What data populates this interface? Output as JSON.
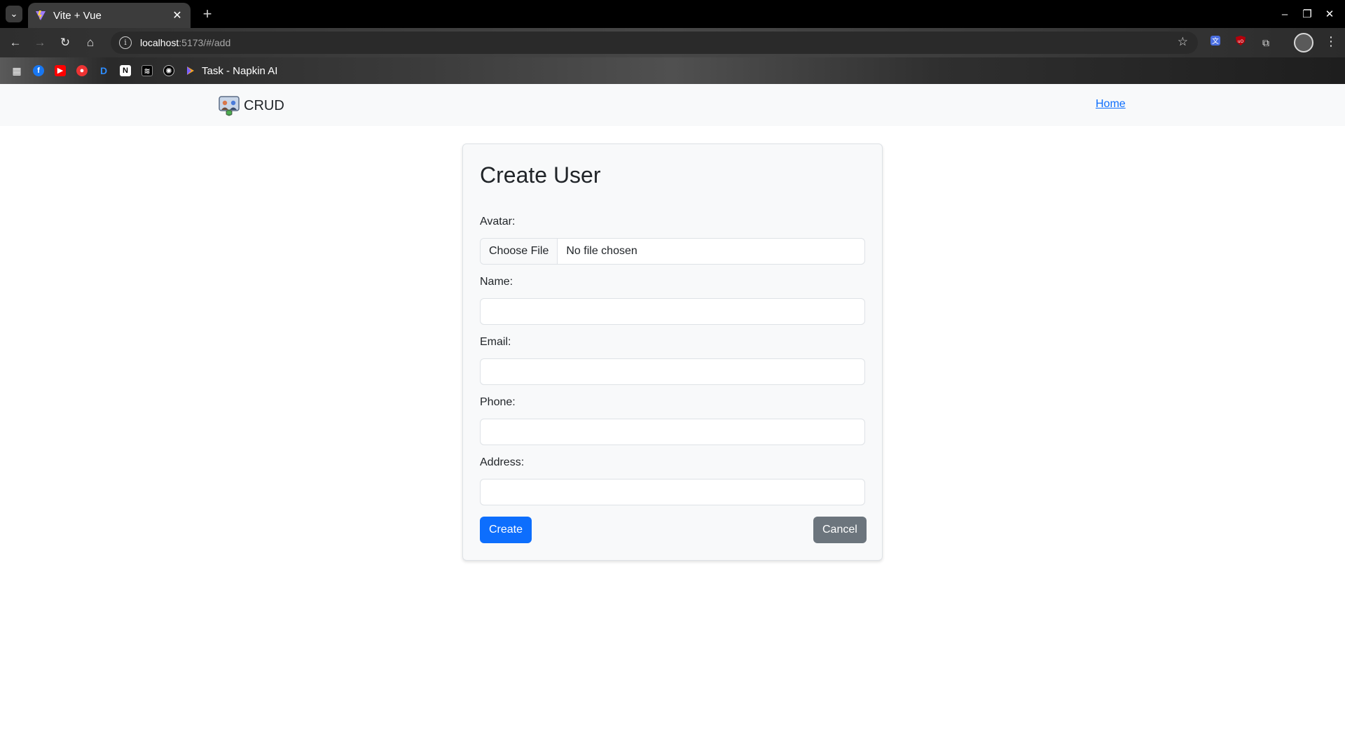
{
  "browser": {
    "tab_title": "Vite + Vue",
    "tab_close": "✕",
    "new_tab": "+",
    "url_host": "localhost",
    "url_path": ":5173/#/add",
    "window_controls": {
      "minimize": "–",
      "maximize": "❐",
      "close": "✕"
    },
    "bookmarks": [
      {
        "label": "Task - Napkin AI"
      }
    ]
  },
  "navbar": {
    "brand": "CRUD",
    "home_link": "Home"
  },
  "form": {
    "title": "Create User",
    "avatar_label": "Avatar:",
    "file_button": "Choose File",
    "file_status": "No file chosen",
    "name_label": "Name:",
    "name_value": "",
    "email_label": "Email:",
    "email_value": "",
    "phone_label": "Phone:",
    "phone_value": "",
    "address_label": "Address:",
    "address_value": "",
    "create_button": "Create",
    "cancel_button": "Cancel"
  },
  "colors": {
    "primary": "#0d6efd",
    "secondary": "#6c757d",
    "navbar_bg": "#f8f9fa",
    "card_bg": "#f8f9fa"
  }
}
